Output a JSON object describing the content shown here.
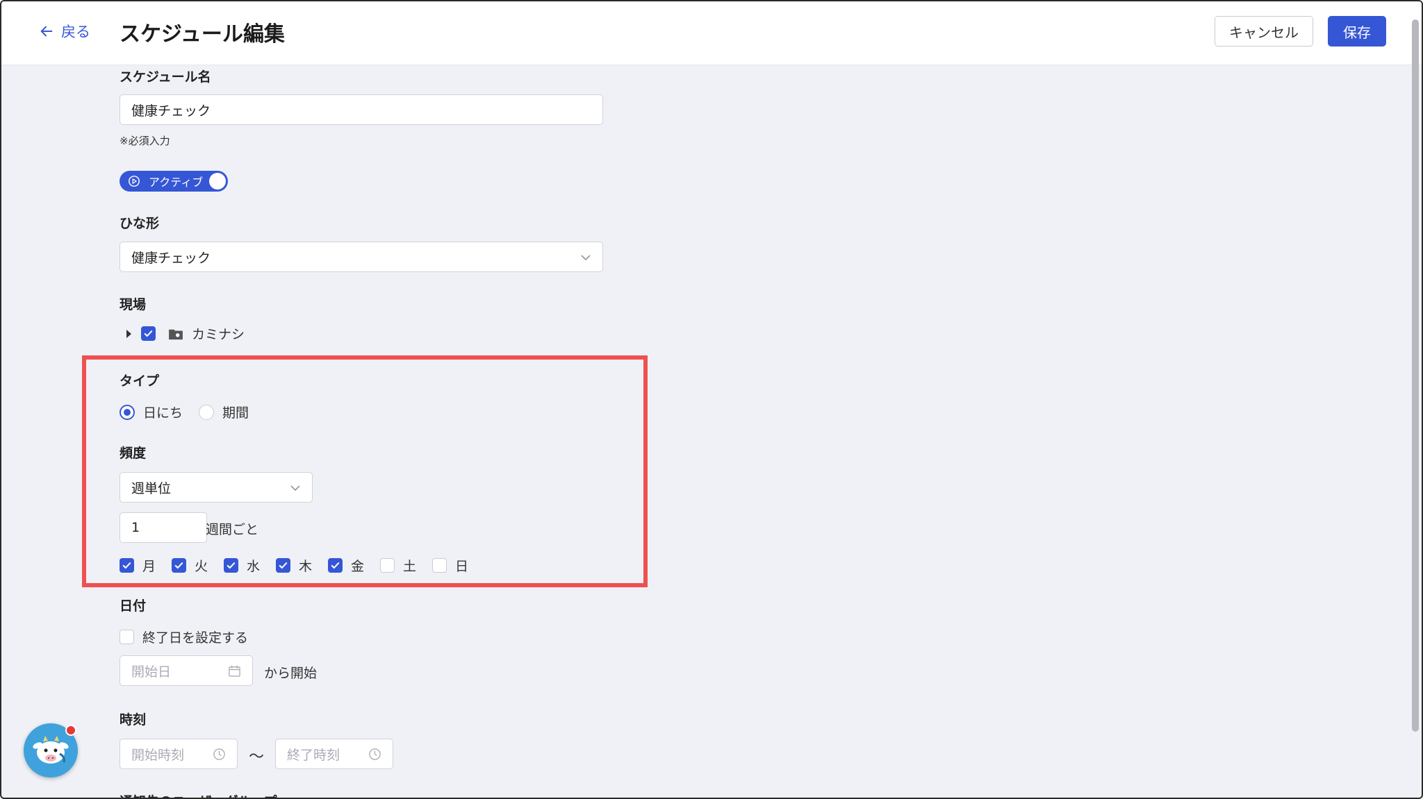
{
  "header": {
    "back_label": "戻る",
    "title": "スケジュール編集",
    "cancel_label": "キャンセル",
    "save_label": "保存"
  },
  "schedule_name": {
    "label": "スケジュール名",
    "value": "健康チェック",
    "required_note": "※必須入力"
  },
  "status_toggle": {
    "label": "アクティブ",
    "on": true
  },
  "template": {
    "label": "ひな形",
    "selected": "健康チェック"
  },
  "site": {
    "label": "現場",
    "items": [
      {
        "label": "カミナシ",
        "checked": true,
        "expanded": false
      }
    ]
  },
  "type": {
    "label": "タイプ",
    "options": [
      {
        "label": "日にち",
        "selected": true
      },
      {
        "label": "期間",
        "selected": false
      }
    ]
  },
  "frequency": {
    "label": "頻度",
    "unit_selected": "週単位",
    "interval_value": "1",
    "interval_suffix": "週間ごと",
    "weekdays": [
      {
        "label": "月",
        "checked": true
      },
      {
        "label": "火",
        "checked": true
      },
      {
        "label": "水",
        "checked": true
      },
      {
        "label": "木",
        "checked": true
      },
      {
        "label": "金",
        "checked": true
      },
      {
        "label": "土",
        "checked": false
      },
      {
        "label": "日",
        "checked": false
      }
    ]
  },
  "date": {
    "label": "日付",
    "end_date_checkbox_label": "終了日を設定する",
    "end_date_checked": false,
    "start_placeholder": "開始日",
    "start_suffix": "から開始"
  },
  "time": {
    "label": "時刻",
    "start_placeholder": "開始時刻",
    "separator": "〜",
    "end_placeholder": "終了時刻"
  },
  "notify": {
    "label": "通知先のユーザーグループ"
  },
  "colors": {
    "accent": "#3557d6",
    "highlight": "#ef5050",
    "background": "#f0f1f6",
    "mascot": "#3fa2dc"
  }
}
